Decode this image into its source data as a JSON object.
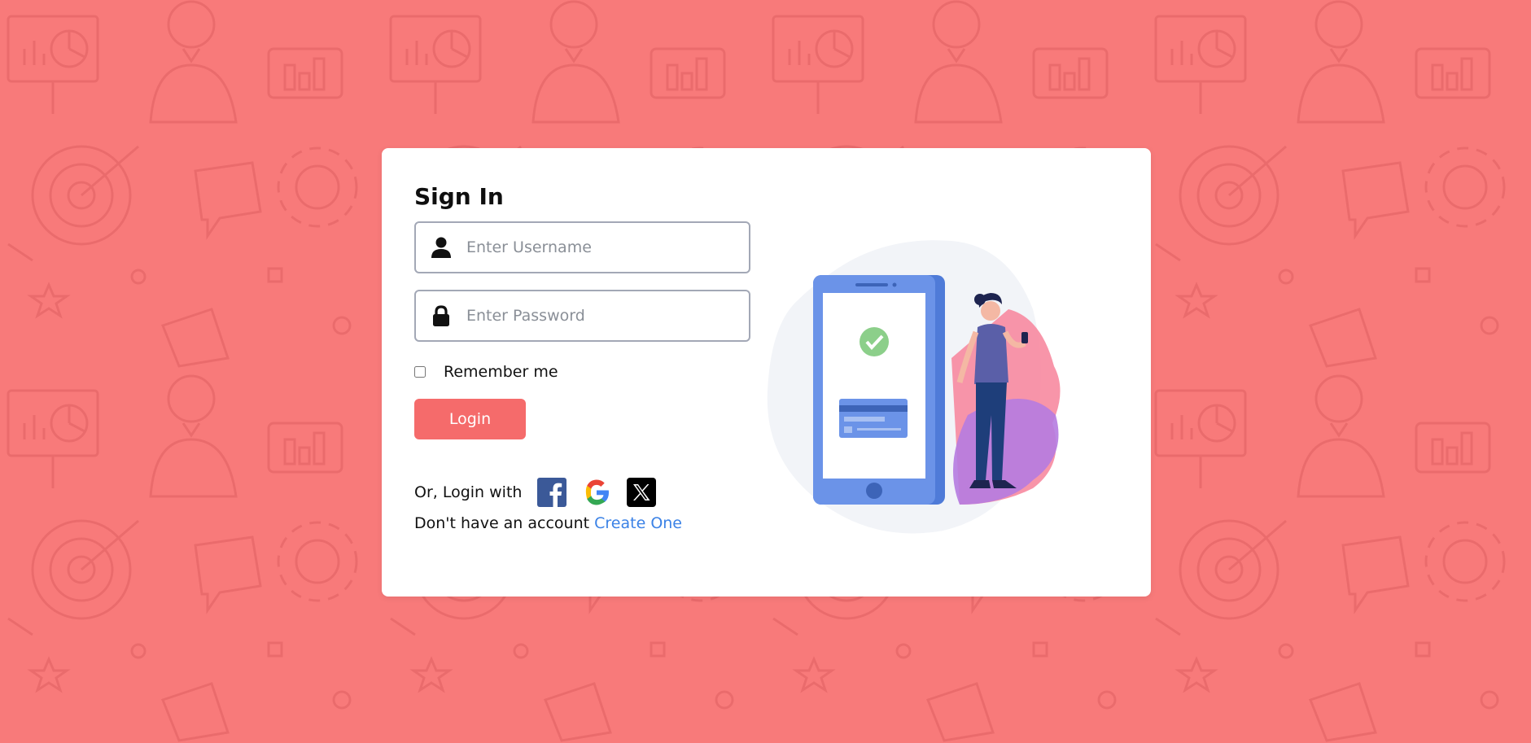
{
  "login": {
    "title": "Sign In",
    "username_placeholder": "Enter Username",
    "password_placeholder": "Enter Password",
    "remember_label": "Remember me",
    "login_button": "Login",
    "or_login_with": "Or, Login with",
    "no_account_text": "Don't have an account",
    "create_link": "Create One"
  },
  "icons": {
    "username": "user-icon",
    "password": "lock-icon",
    "social": [
      "facebook-icon",
      "google-icon",
      "x-icon"
    ]
  },
  "colors": {
    "background": "#f87a7a",
    "accent": "#f56b6b",
    "link": "#3b82e6",
    "facebook": "#3b5998"
  }
}
